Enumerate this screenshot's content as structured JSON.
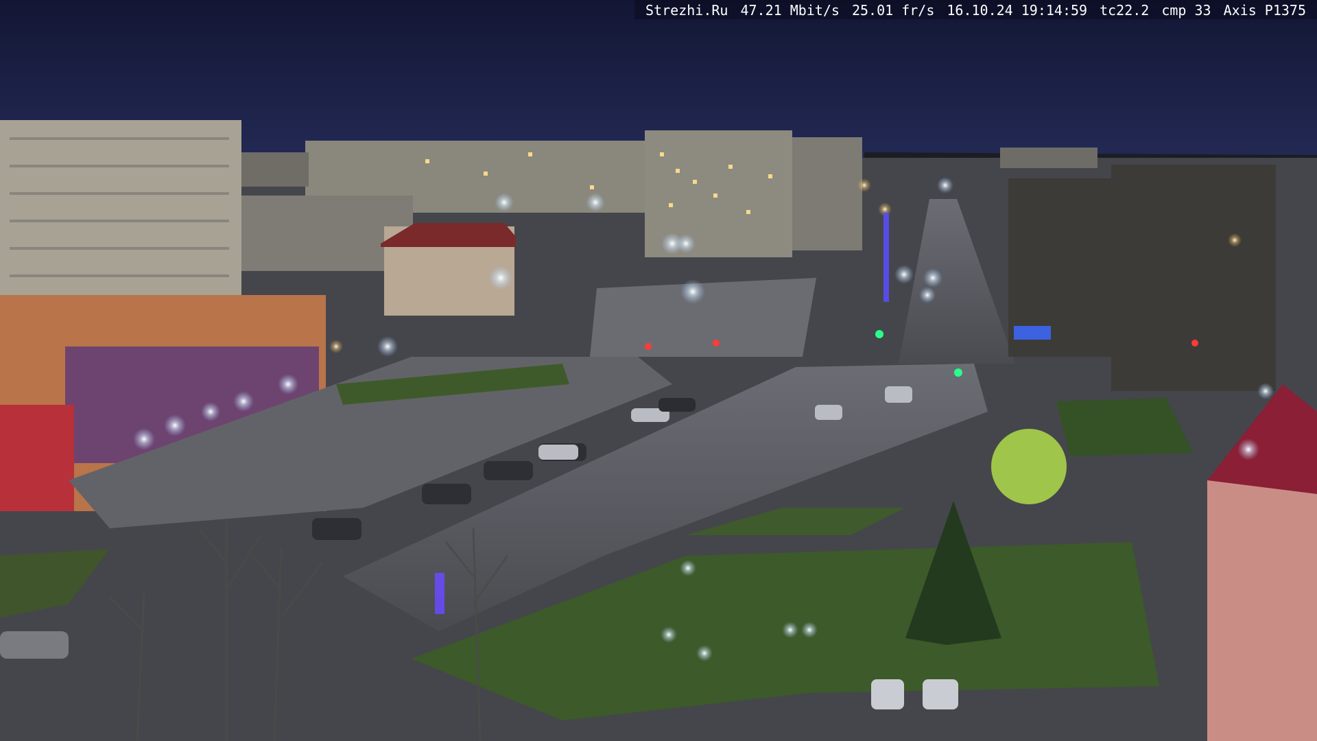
{
  "overlay": {
    "site": "Strezhi.Ru",
    "bitrate": "47.21 Mbit/s",
    "framerate": "25.01 fr/s",
    "datetime": "16.10.24 19:14:59",
    "temperature": "tc22.2",
    "compression": "cmp 33",
    "camera_model": "Axis P1375"
  },
  "scene": {
    "sky_color": "#1b2046",
    "ground_color": "#56575c",
    "lamp_glow_color": "#e6f2ff",
    "grass_color": "#3c5a2a"
  }
}
